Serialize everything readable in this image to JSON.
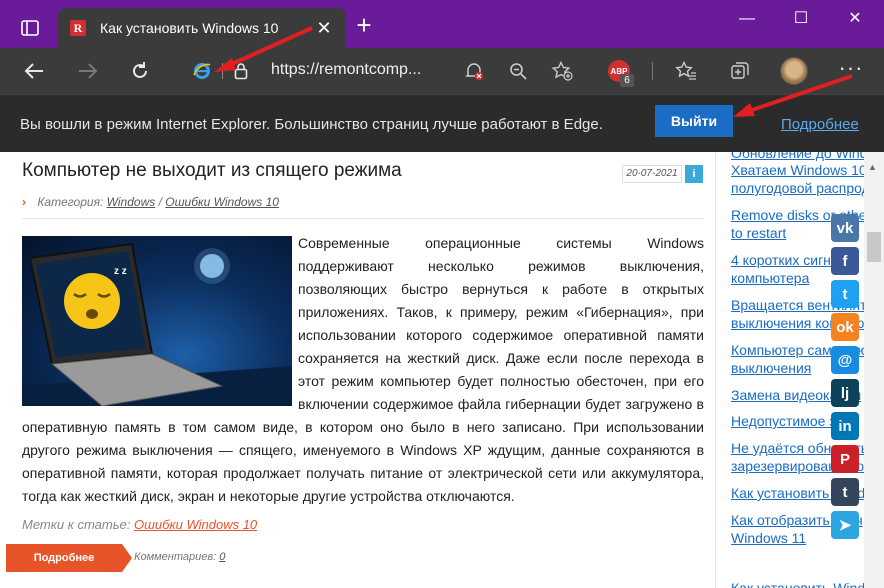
{
  "browser": {
    "tab_title": "Как установить Windows 10",
    "tab_favicon_letter": "R",
    "url": "https://remontcomp...",
    "abp_label": "ABP",
    "abp_count": "6",
    "accent_titlebar": "#6a1b9a",
    "accent_red": "#d32f2f"
  },
  "infobar": {
    "message": "Вы вошли в режим Internet Explorer. Большинство страниц лучше работают в Edge.",
    "exit_label": "Выйти",
    "more_label": "Подробнее"
  },
  "article": {
    "title": "Компьютер не выходит из спящего режима",
    "date": "20-07-2021",
    "info_label": "i",
    "category_prefix": "Категория:",
    "category_1": "Windows",
    "category_sep": "/",
    "category_2": "Ошибки Windows 10",
    "body": "Современные операционные системы Windows поддерживают несколько режимов выключения, позволяющих быстро вернуться к работе в открытых приложениях. Таков, к примеру, режим «Гибернация», при использовании которого содержимое оперативной памяти сохраняется на жесткий диск. Даже если после перехода в этот режим компьютер будет полностью обесточен, при его включении содержимое файла гибернации будет загружено в оперативную память в том самом виде, в котором оно было в него записано. При использовании другого режима выключения — спящего, именуемого в Windows XP ждущим, данные сохраняются в оперативной памяти, которая продолжает получать питание от электрической сети или аккумулятора, тогда как жесткий диск, экран и некоторые другие устройства отключаются.",
    "tags_prefix": "Метки к статье:",
    "tags_link": "Ошибки Windows 10",
    "readmore_label": "Подробнее",
    "comments_prefix": "Комментариев:",
    "comments_count": "0"
  },
  "sidebar": {
    "links": [
      "Обновление до Wind",
      "Хватаем Windows 10",
      "полугодовой распрод",
      "Remove disks or othe",
      "to restart",
      "4 коротких сигнала",
      "компьютера",
      "Вращается вентилят",
      "выключения компьют",
      "Компьютер сам вклю",
      "выключения",
      "Замена видеокарты",
      "Недопустимое знач",
      "Не удаётся обновить",
      "зарезервированного",
      "Как установить Wind",
      "Как отобразить знач",
      "Windows 11",
      "Как установить Wind"
    ]
  },
  "social": [
    {
      "name": "vk",
      "label": "vk",
      "color": "#4a76a8"
    },
    {
      "name": "facebook",
      "label": "f",
      "color": "#3b5998"
    },
    {
      "name": "twitter",
      "label": "t",
      "color": "#1da1f2"
    },
    {
      "name": "odnoklassniki",
      "label": "ok",
      "color": "#f58220"
    },
    {
      "name": "moimir",
      "label": "@",
      "color": "#168de2"
    },
    {
      "name": "livejournal",
      "label": "lj",
      "color": "#0d425a"
    },
    {
      "name": "linkedin",
      "label": "in",
      "color": "#0077b5"
    },
    {
      "name": "pinterest",
      "label": "P",
      "color": "#cb2027"
    },
    {
      "name": "tumblr",
      "label": "t",
      "color": "#35465c"
    },
    {
      "name": "telegram",
      "label": "➤",
      "color": "#2ca5e0"
    }
  ]
}
